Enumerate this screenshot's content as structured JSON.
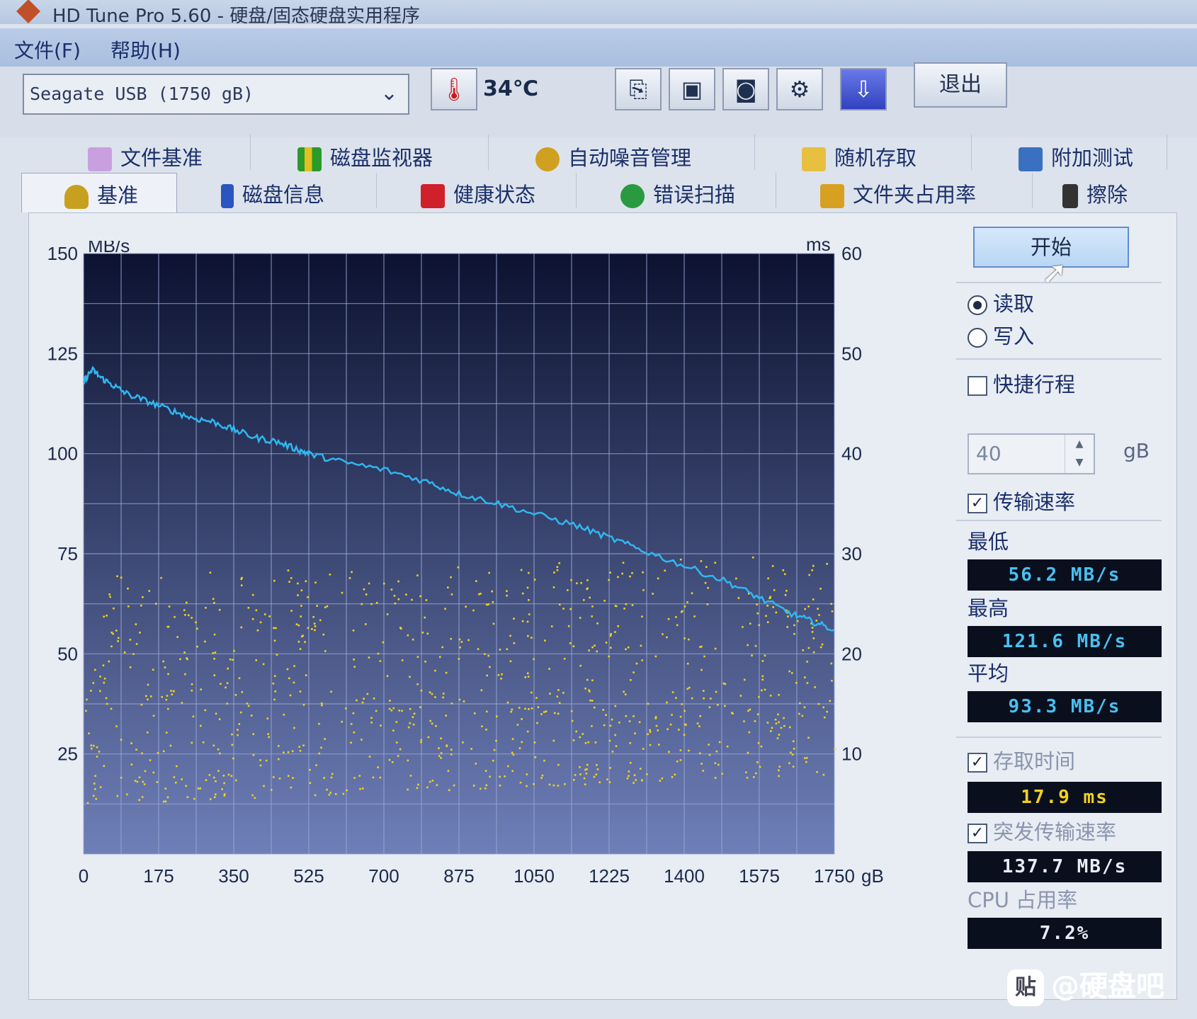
{
  "window": {
    "title": "HD Tune Pro 5.60 - 硬盘/固态硬盘实用程序"
  },
  "menu": {
    "file": "文件(F)",
    "help": "帮助(H)"
  },
  "toolbar": {
    "drive": "Seagate USB (1750 gB)",
    "temperature": "34℃",
    "exit_label": "退出",
    "icons": [
      "copy-text-icon",
      "copy-screen-icon",
      "screenshot-camera-icon",
      "options-icon",
      "save-download-icon"
    ]
  },
  "tabs": {
    "row1": [
      "文件基准",
      "磁盘监视器",
      "自动噪音管理",
      "随机存取",
      "附加测试"
    ],
    "row2": [
      "基准",
      "磁盘信息",
      "健康状态",
      "错误扫描",
      "文件夹占用率",
      "擦除"
    ],
    "active": "基准"
  },
  "controls": {
    "start_label": "开始",
    "read_label": "读取",
    "write_label": "写入",
    "mode": "read",
    "short_stroke_label": "快捷行程",
    "short_stroke_checked": false,
    "short_stroke_value": "40",
    "short_stroke_unit": "gB",
    "transfer_rate_label": "传输速率",
    "transfer_rate_checked": true,
    "access_time_label": "存取时间",
    "access_time_checked": true,
    "burst_rate_label": "突发传输速率",
    "burst_rate_checked": true
  },
  "results": {
    "min_label": "最低",
    "min_value": "56.2 MB/s",
    "max_label": "最高",
    "max_value": "121.6 MB/s",
    "avg_label": "平均",
    "avg_value": "93.3 MB/s",
    "access_value": "17.9 ms",
    "burst_value": "137.7 MB/s",
    "cpu_label": "CPU 占用率",
    "cpu_value": "7.2%"
  },
  "watermark": {
    "badge": "贴",
    "text": "@硬盘吧"
  },
  "chart_data": {
    "type": "line",
    "y_left_unit": "MB/s",
    "y_right_unit": "ms",
    "x_unit": "gB",
    "xlim": [
      0,
      1750
    ],
    "ylim_left": [
      0,
      150
    ],
    "ylim_right": [
      0,
      60
    ],
    "x_ticks": [
      0,
      175,
      350,
      525,
      700,
      875,
      1050,
      1225,
      1400,
      1575,
      1750
    ],
    "y_left_ticks": [
      25,
      50,
      75,
      100,
      125,
      150
    ],
    "y_right_ticks": [
      10,
      20,
      30,
      40,
      50,
      60
    ],
    "grid": true,
    "colors": {
      "transfer": "#2fb7f0",
      "access": "#f0d21c",
      "bg_top": "#0c1230",
      "bg_bottom": "#6e7fb8",
      "grid": "#9aa9d6"
    },
    "series": [
      {
        "axis": "left",
        "x": [
          0,
          20,
          40,
          70,
          100,
          150,
          200,
          250,
          300,
          350,
          400,
          450,
          500,
          525,
          600,
          700,
          800,
          875,
          950,
          1050,
          1150,
          1225,
          1300,
          1400,
          1500,
          1575,
          1650,
          1700,
          1750
        ],
        "y": [
          118,
          121,
          119,
          117,
          115,
          113,
          111,
          109,
          108,
          106,
          104,
          103,
          101,
          100,
          98,
          96,
          93,
          90,
          88,
          85,
          82,
          79,
          76,
          72,
          68,
          64,
          60,
          58,
          56
        ]
      }
    ],
    "access_scatter": {
      "axis": "right",
      "range_ms": [
        5,
        30
      ],
      "count": 900
    }
  }
}
